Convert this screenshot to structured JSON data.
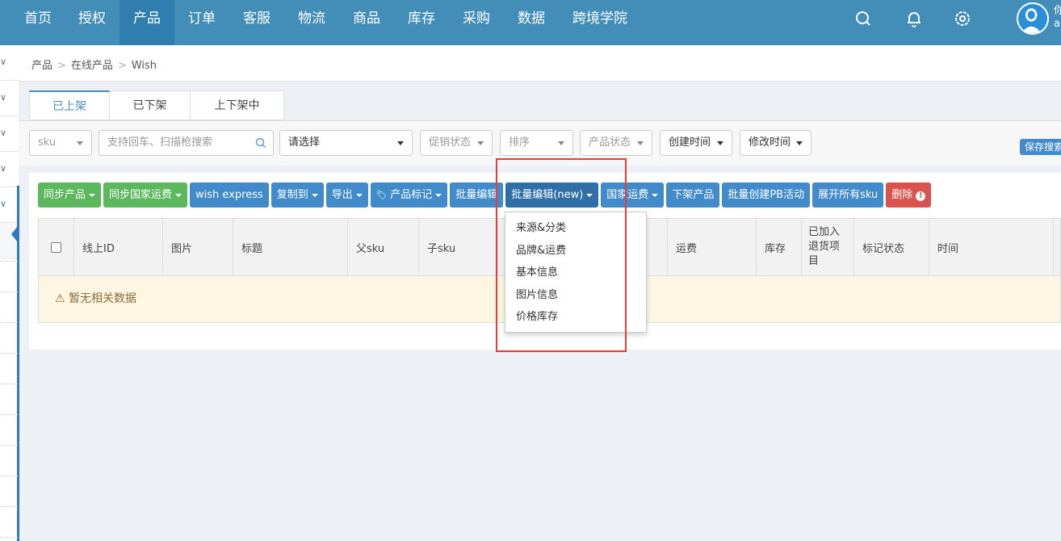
{
  "topnav": {
    "items": [
      "首页",
      "授权",
      "产品",
      "订单",
      "客服",
      "物流",
      "商品",
      "库存",
      "采购",
      "数据",
      "跨境学院"
    ],
    "active": 2,
    "icons": [
      "search-icon",
      "bell-icon",
      "gear-icon"
    ],
    "user_line1": "你",
    "user_line2": "a"
  },
  "breadcrumb": [
    "产品",
    "在线产品",
    "Wish"
  ],
  "tabs": [
    "已上架",
    "已下架",
    "上下架中"
  ],
  "filters": {
    "sku": "sku",
    "search_placeholder": "支持回车、扫描枪搜索",
    "select": "请选择",
    "promo": "促销状态",
    "sort": "排序",
    "status": "产品状态",
    "created": "创建时间",
    "modified": "修改时间",
    "save_search": "保存搜索"
  },
  "actions": [
    {
      "label": "同步产品",
      "color": "green",
      "caret": true
    },
    {
      "label": "同步国家运费",
      "color": "green",
      "caret": true
    },
    {
      "label": "wish express",
      "color": "blue",
      "caret": false
    },
    {
      "label": "复制到",
      "color": "blue",
      "caret": true
    },
    {
      "label": "导出",
      "color": "blue",
      "caret": true
    },
    {
      "label": "产品标记",
      "color": "blue",
      "caret": true,
      "icon": "tag-icon"
    },
    {
      "label": "批量编辑",
      "color": "blue",
      "caret": false
    },
    {
      "label": "批量编辑(new)",
      "color": "dark",
      "caret": true
    },
    {
      "label": "国家运费",
      "color": "blue",
      "caret": true
    },
    {
      "label": "下架产品",
      "color": "blue",
      "caret": false
    },
    {
      "label": "批量创建PB活动",
      "color": "blue",
      "caret": false
    },
    {
      "label": "展开所有sku",
      "color": "blue",
      "caret": false
    },
    {
      "label": "删除",
      "color": "red",
      "caret": false,
      "icon": "exclamation-circle-icon"
    }
  ],
  "table": {
    "columns": [
      "",
      "线上ID",
      "图片",
      "标题",
      "父sku",
      "子sku",
      "",
      "运费",
      "库存",
      "已加入退货项目",
      "标记状态",
      "时间"
    ],
    "empty_text": "暂无相关数据"
  },
  "dropdown": {
    "items": [
      "来源&分类",
      "品牌&运费",
      "基本信息",
      "图片信息",
      "价格库存"
    ]
  },
  "colors": {
    "topbar": "#438eb9",
    "primary": "#428bca",
    "success": "#5cb85c",
    "danger": "#d9534f",
    "highlight": "#f03a3a"
  }
}
